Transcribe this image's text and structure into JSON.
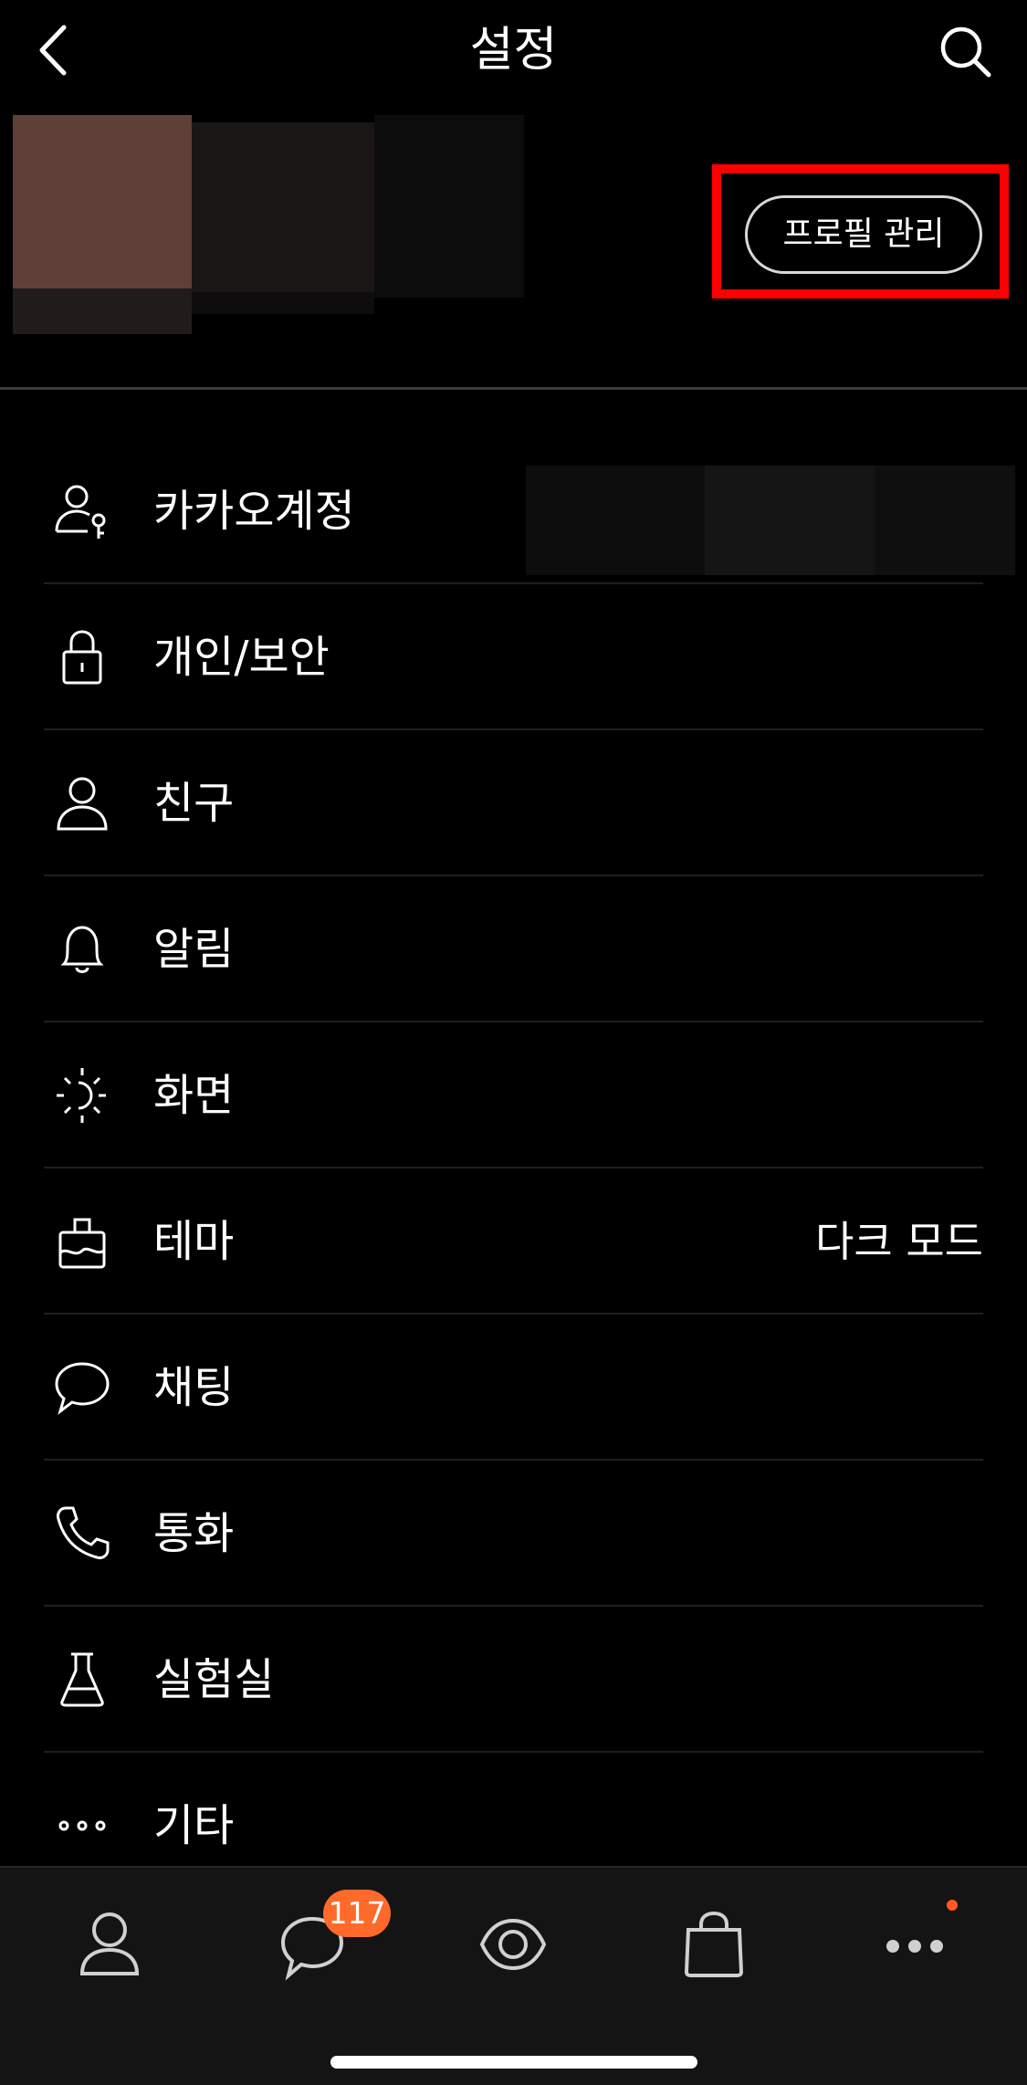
{
  "header": {
    "title": "설정",
    "back_icon": "chevron-left-icon",
    "search_icon": "search-icon"
  },
  "profile": {
    "manage_button_label": "프로필 관리",
    "highlight_color": "#ff0000"
  },
  "menu": {
    "items": [
      {
        "label": "카카오계정",
        "icon": "account-key-icon"
      },
      {
        "label": "개인/보안",
        "icon": "lock-icon"
      },
      {
        "label": "친구",
        "icon": "person-icon"
      },
      {
        "label": "알림",
        "icon": "bell-icon"
      },
      {
        "label": "화면",
        "icon": "brightness-icon"
      },
      {
        "label": "테마",
        "icon": "paint-icon",
        "value": "다크 모드"
      },
      {
        "label": "채팅",
        "icon": "chat-bubble-icon"
      },
      {
        "label": "통화",
        "icon": "phone-icon"
      },
      {
        "label": "실험실",
        "icon": "flask-icon"
      },
      {
        "label": "기타",
        "icon": "more-dots-icon"
      }
    ]
  },
  "tabbar": {
    "tabs": [
      {
        "name": "friends",
        "icon": "person-icon"
      },
      {
        "name": "chats",
        "icon": "chat-bubble-icon",
        "badge": "117"
      },
      {
        "name": "view",
        "icon": "eye-icon"
      },
      {
        "name": "shopping",
        "icon": "shopping-bag-icon"
      },
      {
        "name": "more",
        "icon": "more-dots-icon",
        "has_dot": true
      }
    ],
    "badge_color": "#ff6a2b"
  }
}
